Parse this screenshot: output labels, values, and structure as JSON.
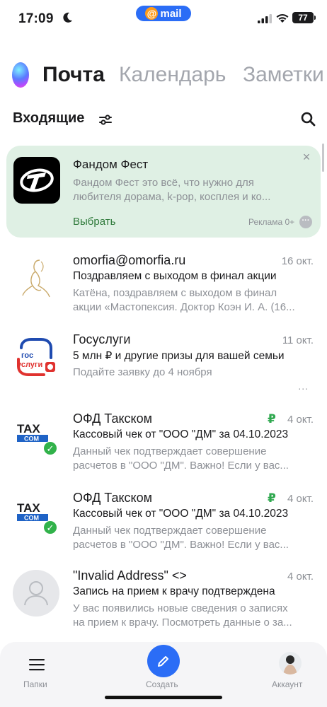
{
  "status_bar": {
    "time": "17:09",
    "badge": "mail",
    "badge_icon": "@",
    "battery": "77"
  },
  "app_tabs": [
    {
      "label": "Почта",
      "active": true
    },
    {
      "label": "Календарь",
      "active": false
    },
    {
      "label": "Заметки",
      "active": false
    }
  ],
  "inbox": {
    "title": "Входящие",
    "filter_icon": "filter-icon",
    "search_icon": "search-icon"
  },
  "ad": {
    "title": "Фандом Фест",
    "text_line1": "Фандом Фест это всё, что нужно для",
    "text_line2": "любителя дорама, k-pop, косплея и ко...",
    "cta": "Выбрать",
    "badge": "Реклама 0+",
    "colors": {
      "background": "#dff0e4",
      "cta": "#2f7a3b"
    }
  },
  "messages": [
    {
      "sender": "omorfia@omorfia.ru",
      "date": "16 окт.",
      "subject": "Поздравляем с выходом в финал акции",
      "preview_line1": "Катёна, поздравляем с выходом в финал",
      "preview_line2": "акции «Мастопексия. Доктор Коэн И. А. (16..."
    },
    {
      "sender": "Госуслуги",
      "date": "11 окт.",
      "subject": "5 млн ₽ и другие призы для вашей семьи",
      "preview_line1": "Подайте заявку до 4 ноября",
      "preview_line2": "",
      "more": "..."
    },
    {
      "sender": "ОФД Такском",
      "date": "4 окт.",
      "mark": "₽",
      "subject": "Кассовый чек от \"ООО \"ДМ\" за 04.10.2023",
      "preview_line1": "Данный чек подтверждает совершение",
      "preview_line2": "расчетов в \"ООО \"ДМ\". Важно! Если у вас..."
    },
    {
      "sender": "ОФД Такском",
      "date": "4 окт.",
      "mark": "₽",
      "subject": "Кассовый чек от \"ООО \"ДМ\" за 04.10.2023",
      "preview_line1": "Данный чек подтверждает совершение",
      "preview_line2": "расчетов в \"ООО \"ДМ\". Важно! Если у вас..."
    },
    {
      "sender": "\"Invalid Address\" <>",
      "date": "4 окт.",
      "subject": "Запись на прием к врачу подтверждена",
      "preview_line1": "У вас появились новые сведения о записях",
      "preview_line2": "на прием к врачу. Посмотреть данные о за..."
    }
  ],
  "gosuslugi_logo": {
    "line1": "гос",
    "line2": "услуги"
  },
  "taxcom_logo": {
    "line1": "TAX",
    "line2": "COM"
  },
  "bottom_nav": {
    "folders": "Папки",
    "compose": "Создать",
    "account": "Аккаунт"
  },
  "colors": {
    "accent": "#2b6df6",
    "muted": "#8d9096",
    "ruble": "#2fa84f"
  }
}
